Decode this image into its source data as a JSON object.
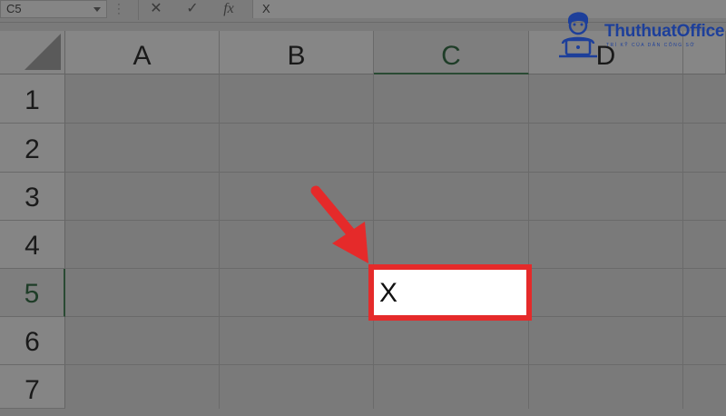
{
  "formula_bar": {
    "name_box": "C5",
    "cancel_icon": "✕",
    "enter_icon": "✓",
    "function_icon": "fx",
    "content": "X"
  },
  "columns": [
    {
      "label": "A",
      "active": false
    },
    {
      "label": "B",
      "active": false
    },
    {
      "label": "C",
      "active": true
    },
    {
      "label": "D",
      "active": false
    }
  ],
  "rows": [
    {
      "label": "1",
      "active": false
    },
    {
      "label": "2",
      "active": false
    },
    {
      "label": "3",
      "active": false
    },
    {
      "label": "4",
      "active": false
    },
    {
      "label": "5",
      "active": true
    },
    {
      "label": "6",
      "active": false
    },
    {
      "label": "7",
      "active": false
    }
  ],
  "active_cell": {
    "reference": "C5",
    "value": "X"
  },
  "logo": {
    "brand": "ThuthuatOffice",
    "tagline": "TRÍ KỸ CỦA DÂN CÔNG SỞ"
  },
  "colors": {
    "highlight": "#e52a2a",
    "active_header_text": "#1f3d28",
    "brand": "#1d3f9a"
  }
}
